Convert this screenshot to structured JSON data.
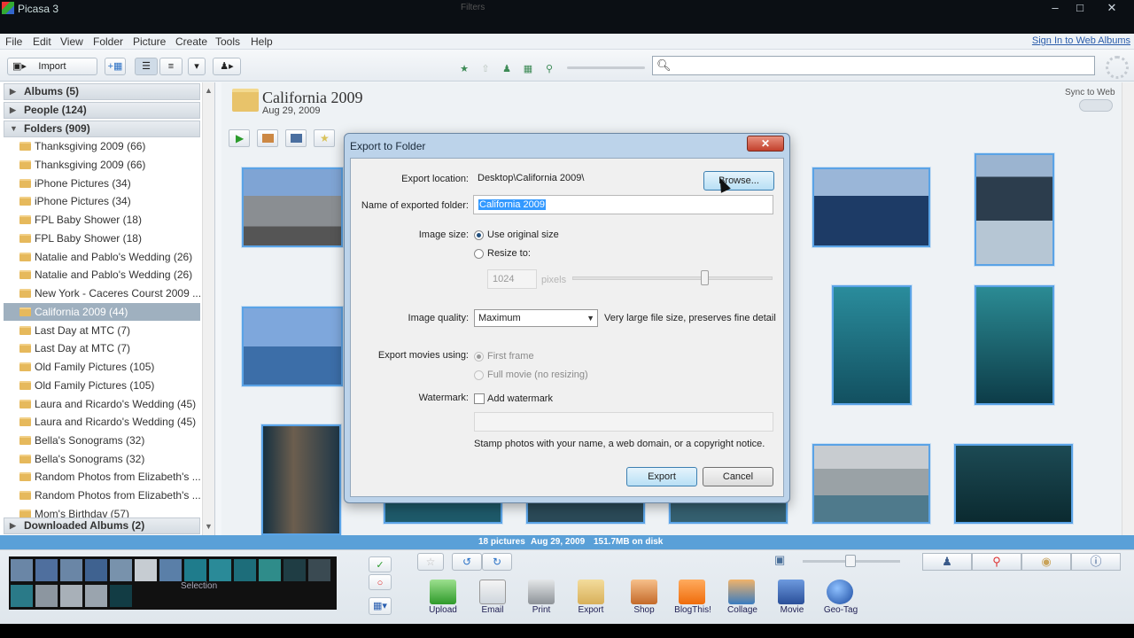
{
  "window": {
    "title": "Picasa 3",
    "min": "–",
    "max": "□",
    "close": "✕"
  },
  "menu": [
    "File",
    "Edit",
    "View",
    "Folder",
    "Picture",
    "Create",
    "Tools",
    "Help"
  ],
  "signin": "Sign In to Web Albums",
  "toolbar": {
    "import": "Import",
    "filters_label": "Filters",
    "search_placeholder": ""
  },
  "library": {
    "albums": "Albums (5)",
    "people": "People (124)",
    "folders": "Folders (909)",
    "folder_items": [
      "Thanksgiving 2009 (66)",
      "Thanksgiving 2009 (66)",
      "iPhone Pictures (34)",
      "iPhone Pictures (34)",
      "FPL Baby Shower (18)",
      "FPL Baby Shower (18)",
      "Natalie and Pablo's Wedding (26)",
      "Natalie and Pablo's Wedding (26)",
      "New York - Caceres Courst 2009 ...",
      "California 2009 (44)",
      "Last Day at MTC (7)",
      "Last Day at MTC (7)",
      "Old Family Pictures (105)",
      "Old Family Pictures (105)",
      "Laura and Ricardo's Wedding (45)",
      "Laura and Ricardo's Wedding (45)",
      "Bella's Sonograms (32)",
      "Bella's Sonograms (32)",
      "Random Photos from Elizabeth's ...",
      "Random Photos from Elizabeth's ...",
      "Mom's Birthday (57)"
    ],
    "downloaded": "Downloaded Albums (2)"
  },
  "album": {
    "title": "California 2009",
    "date": "Aug 29, 2009",
    "sync": "Sync to Web"
  },
  "status": {
    "count": "18 pictures",
    "date": "Aug 29, 2009",
    "size": "151.7MB on disk"
  },
  "tray": {
    "selection": "Selection"
  },
  "actions": [
    "Upload",
    "Email",
    "Print",
    "Export",
    "Shop",
    "BlogThis!",
    "Collage",
    "Movie",
    "Geo-Tag"
  ],
  "dialog": {
    "title": "Export to Folder",
    "close": "✕",
    "export_location_label": "Export location:",
    "export_location": "Desktop\\California 2009\\",
    "browse": "Browse...",
    "folder_name_label": "Name of exported folder:",
    "folder_name": "California 2009",
    "image_size_label": "Image size:",
    "use_original": "Use original size",
    "resize_to": "Resize to:",
    "resize_value": "1024",
    "pixels": "pixels",
    "quality_label": "Image quality:",
    "quality": "Maximum",
    "quality_note": "Very large file size, preserves fine detail",
    "movies_label": "Export movies using:",
    "first_frame": "First frame",
    "full_movie": "Full movie (no resizing)",
    "watermark_label": "Watermark:",
    "add_watermark": "Add watermark",
    "watermark_hint": "Stamp photos with your name, a web domain, or a copyright notice.",
    "export": "Export",
    "cancel": "Cancel"
  }
}
